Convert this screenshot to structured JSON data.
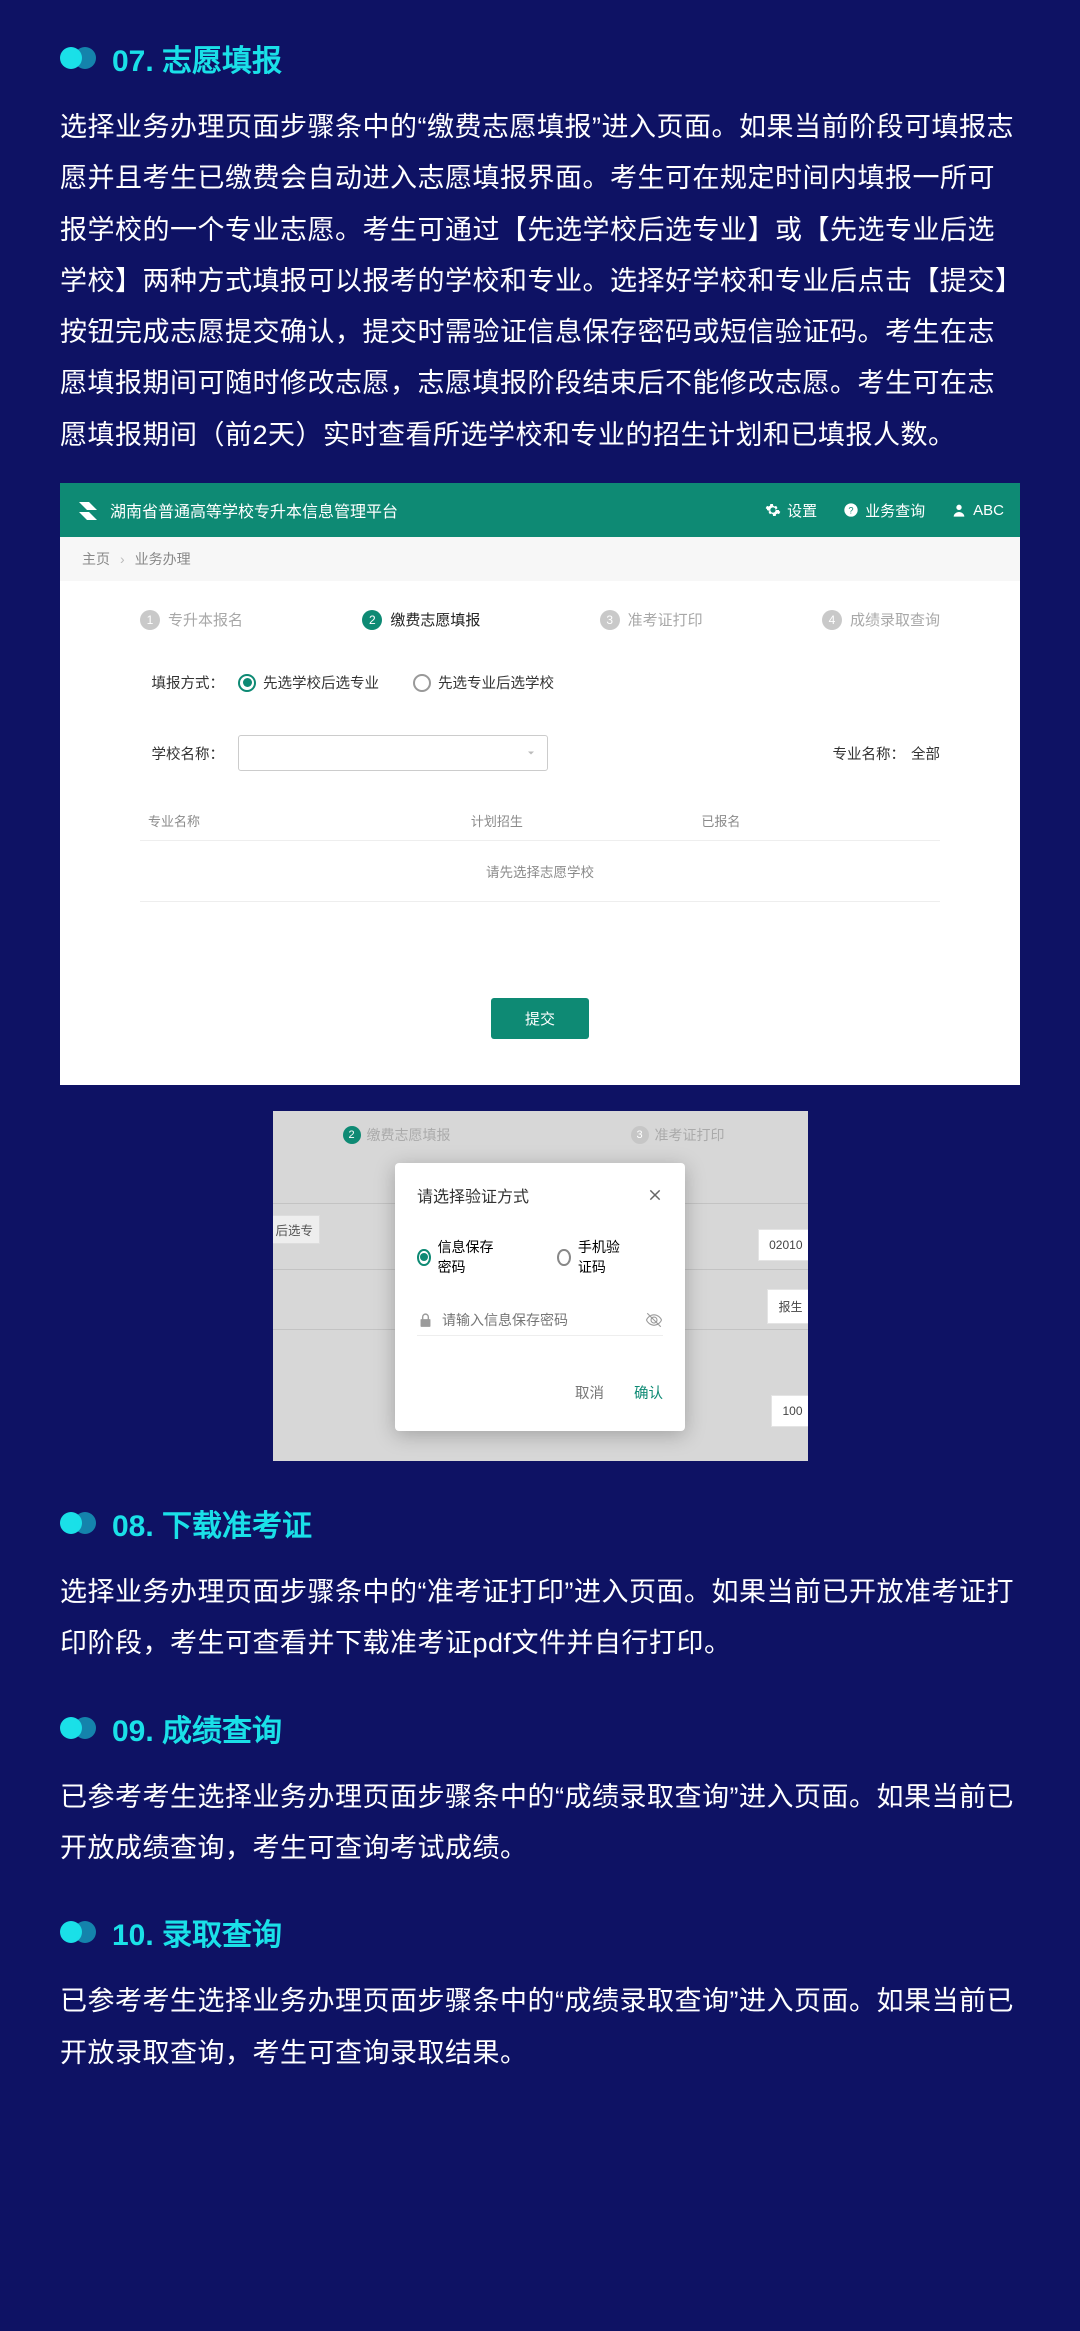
{
  "sections": {
    "s07": {
      "heading": "07. 志愿填报",
      "body": "选择业务办理页面步骤条中的“缴费志愿填报”进入页面。如果当前阶段可填报志愿并且考生已缴费会自动进入志愿填报界面。考生可在规定时间内填报一所可报学校的一个专业志愿。考生可通过【先选学校后选专业】或【先选专业后选学校】两种方式填报可以报考的学校和专业。选择好学校和专业后点击【提交】按钮完成志愿提交确认，提交时需验证信息保存密码或短信验证码。考生在志愿填报期间可随时修改志愿，志愿填报阶段结束后不能修改志愿。考生可在志愿填报期间（前2天）实时查看所选学校和专业的招生计划和已填报人数。"
    },
    "s08": {
      "heading": "08. 下载准考证",
      "body": "选择业务办理页面步骤条中的“准考证打印”进入页面。如果当前已开放准考证打印阶段，考生可查看并下载准考证pdf文件并自行打印。"
    },
    "s09": {
      "heading": "09. 成绩查询",
      "body": "已参考考生选择业务办理页面步骤条中的“成绩录取查询”进入页面。如果当前已开放成绩查询，考生可查询考试成绩。"
    },
    "s10": {
      "heading": "10. 录取查询",
      "body": "已参考考生选择业务办理页面步骤条中的“成绩录取查询”进入页面。如果当前已开放录取查询，考生可查询录取结果。"
    }
  },
  "shot1": {
    "title": "湖南省普通高等学校专升本信息管理平台",
    "settings": "设置",
    "query": "业务查询",
    "user": "ABC",
    "crumb1": "主页",
    "crumb2": "业务办理",
    "steps": {
      "s1": "专升本报名",
      "s2": "缴费志愿填报",
      "s3": "准考证打印",
      "s4": "成绩录取查询"
    },
    "form": {
      "mode_label": "填报方式：",
      "radio1": "先选学校后选专业",
      "radio2": "先选专业后选学校",
      "school_label": "学校名称：",
      "major_label": "专业名称：",
      "major_all": "全部"
    },
    "table": {
      "col1": "专业名称",
      "col2": "计划招生",
      "col3": "已报名",
      "empty": "请先选择志愿学校"
    },
    "submit": "提交"
  },
  "shot2": {
    "bg_step2": "缴费志愿填报",
    "bg_step3": "准考证打印",
    "bg_left": "后选专",
    "bg_right1": "02010",
    "bg_right2": "报生",
    "bg_right3": "100"
  },
  "dialog": {
    "title": "请选择验证方式",
    "radio1": "信息保存密码",
    "radio2": "手机验证码",
    "placeholder": "请输入信息保存密码",
    "cancel": "取消",
    "ok": "确认"
  }
}
